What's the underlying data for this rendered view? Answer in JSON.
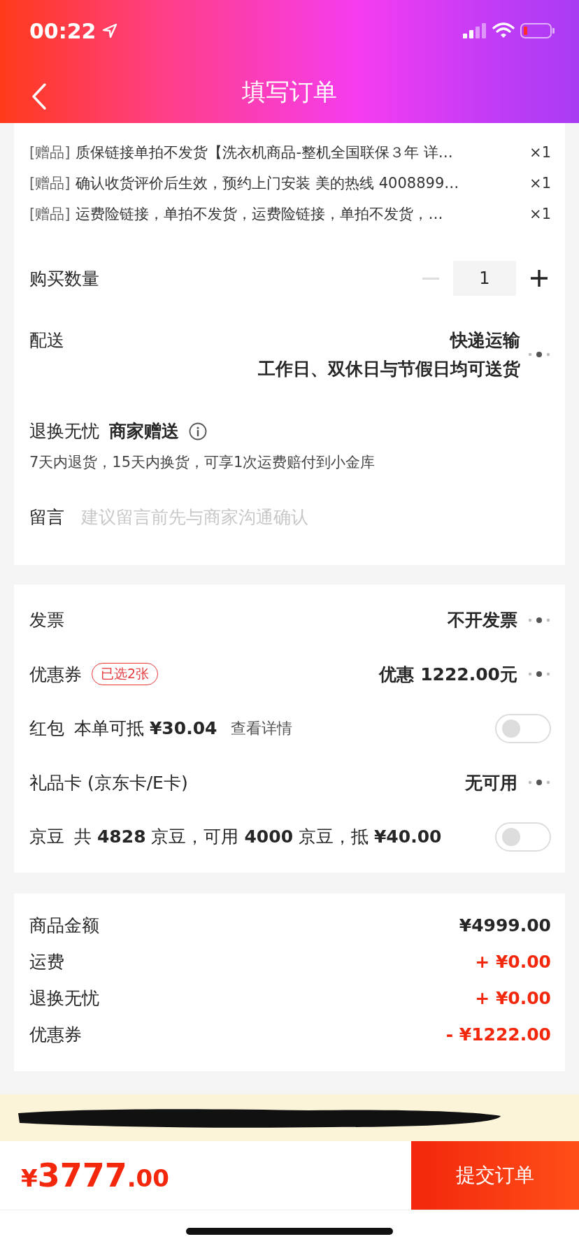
{
  "status_bar": {
    "time": "00:22"
  },
  "header": {
    "title": "填写订单"
  },
  "gifts": [
    {
      "tag": "[赠品]",
      "text": "质保链接单拍不发货【洗衣机商品-整机全国联保３年 详…",
      "qty": "×1"
    },
    {
      "tag": "[赠品]",
      "text": "确认收货评价后生效，预约上门安装 美的热线 4008899…",
      "qty": "×1"
    },
    {
      "tag": "[赠品]",
      "text": "运费险链接，单拍不发货，运费险链接，单拍不发货，…",
      "qty": "×1"
    }
  ],
  "quantity": {
    "label": "购买数量",
    "value": "1",
    "decrease_disabled": true
  },
  "delivery": {
    "label": "配送",
    "method": "快递运输",
    "note": "工作日、双休日与节假日均可送货"
  },
  "return_service": {
    "label": "退换无忧",
    "badge": "商家赠送",
    "description": "7天内退货，15天内换货，可享1次运费赔付到小金库"
  },
  "message": {
    "label": "留言",
    "placeholder": "建议留言前先与商家沟通确认"
  },
  "payment": {
    "rows": [
      {
        "kind": "link",
        "label": "发票",
        "value": "不开发票"
      },
      {
        "kind": "link",
        "label": "优惠券",
        "tag": "已选2张",
        "value": "优惠 1222.00元"
      },
      {
        "kind": "toggle",
        "label": "红包",
        "detail": "本单可抵 **¥30.04**",
        "link": "查看详情",
        "on": false
      },
      {
        "kind": "link",
        "label": "礼品卡 (京东卡/E卡)",
        "value": "无可用"
      },
      {
        "kind": "toggle",
        "label": "京豆",
        "detail": "共 **4828** 京豆，可用 **4000** 京豆，抵 **¥40.00**",
        "on": false
      }
    ]
  },
  "summary": [
    {
      "label": "商品金额",
      "amount": "¥4999.00",
      "highlight": false
    },
    {
      "label": "运费",
      "amount": "+ ¥0.00",
      "highlight": true
    },
    {
      "label": "退换无忧",
      "amount": "+ ¥0.00",
      "highlight": true
    },
    {
      "label": "优惠券",
      "amount": "- ¥1222.00",
      "highlight": true
    }
  ],
  "total": {
    "currency": "¥",
    "integer": "3777",
    "decimals": ".00"
  },
  "submit": {
    "label": "提交订单"
  }
}
